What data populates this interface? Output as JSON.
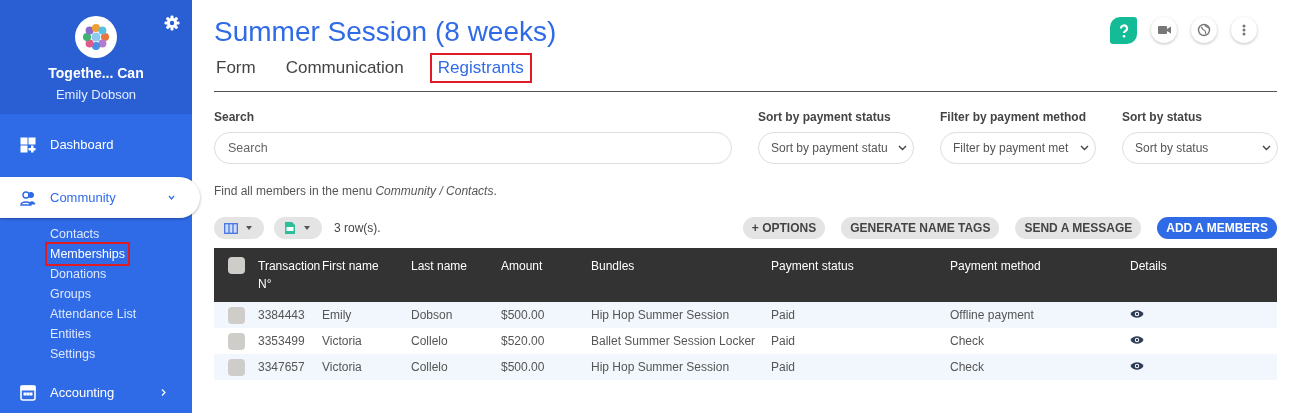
{
  "sidebar": {
    "org_name": "Togethe... Can",
    "user_name": "Emily Dobson",
    "items": [
      {
        "label": "Dashboard",
        "kind": "link",
        "selected": false
      },
      {
        "label": "Community",
        "kind": "group",
        "selected": true,
        "expanded": true,
        "children": [
          {
            "label": "Contacts",
            "selected": false,
            "highlighted": false
          },
          {
            "label": "Memberships",
            "selected": true,
            "highlighted": true
          },
          {
            "label": "Donations",
            "selected": false,
            "highlighted": false
          },
          {
            "label": "Groups",
            "selected": false,
            "highlighted": false
          },
          {
            "label": "Attendance List",
            "selected": false,
            "highlighted": false
          },
          {
            "label": "Entities",
            "selected": false,
            "highlighted": false
          },
          {
            "label": "Settings",
            "selected": false,
            "highlighted": false
          }
        ]
      },
      {
        "label": "Accounting",
        "kind": "group",
        "selected": false,
        "expanded": false
      }
    ]
  },
  "page": {
    "title": "Summer Session (8 weeks)",
    "tabs": [
      {
        "label": "Form",
        "selected": false,
        "highlighted": false
      },
      {
        "label": "Communication",
        "selected": false,
        "highlighted": false
      },
      {
        "label": "Registrants",
        "selected": true,
        "highlighted": true
      }
    ],
    "search": {
      "label": "Search",
      "placeholder": "Search"
    },
    "filters": [
      {
        "label": "Sort by payment status",
        "value": "Sort by payment statu"
      },
      {
        "label": "Filter by payment method",
        "value": "Filter by payment met"
      },
      {
        "label": "Sort by status",
        "value": "Sort by status"
      }
    ],
    "hint": "Find all members in the menu *Community / Contacts*.",
    "row_count": "3 row(s).",
    "buttons": [
      {
        "label": "+ OPTIONS",
        "kind": "secondary"
      },
      {
        "label": "GENERATE NAME TAGS",
        "kind": "secondary"
      },
      {
        "label": "SEND A MESSAGE",
        "kind": "secondary"
      },
      {
        "label": "ADD A MEMBERS",
        "kind": "primary"
      }
    ],
    "table": {
      "all_checked": false,
      "columns": [
        "Transaction N°",
        "First name",
        "Last name",
        "Amount",
        "Bundles",
        "Payment status",
        "Payment method",
        "Details"
      ],
      "rows": [
        {
          "checked": false,
          "cells": [
            "3384443",
            "Emily",
            "Dobson",
            "$500.00",
            "Hip Hop Summer Session",
            "Paid",
            "Offline payment"
          ]
        },
        {
          "checked": false,
          "cells": [
            "3353499",
            "Victoria",
            "Collelo",
            "$520.00",
            "Ballet Summer Session Locker",
            "Paid",
            "Check"
          ]
        },
        {
          "checked": false,
          "cells": [
            "3347657",
            "Victoria",
            "Collelo",
            "$500.00",
            "Hip Hop Summer Session",
            "Paid",
            "Check"
          ]
        }
      ]
    }
  }
}
